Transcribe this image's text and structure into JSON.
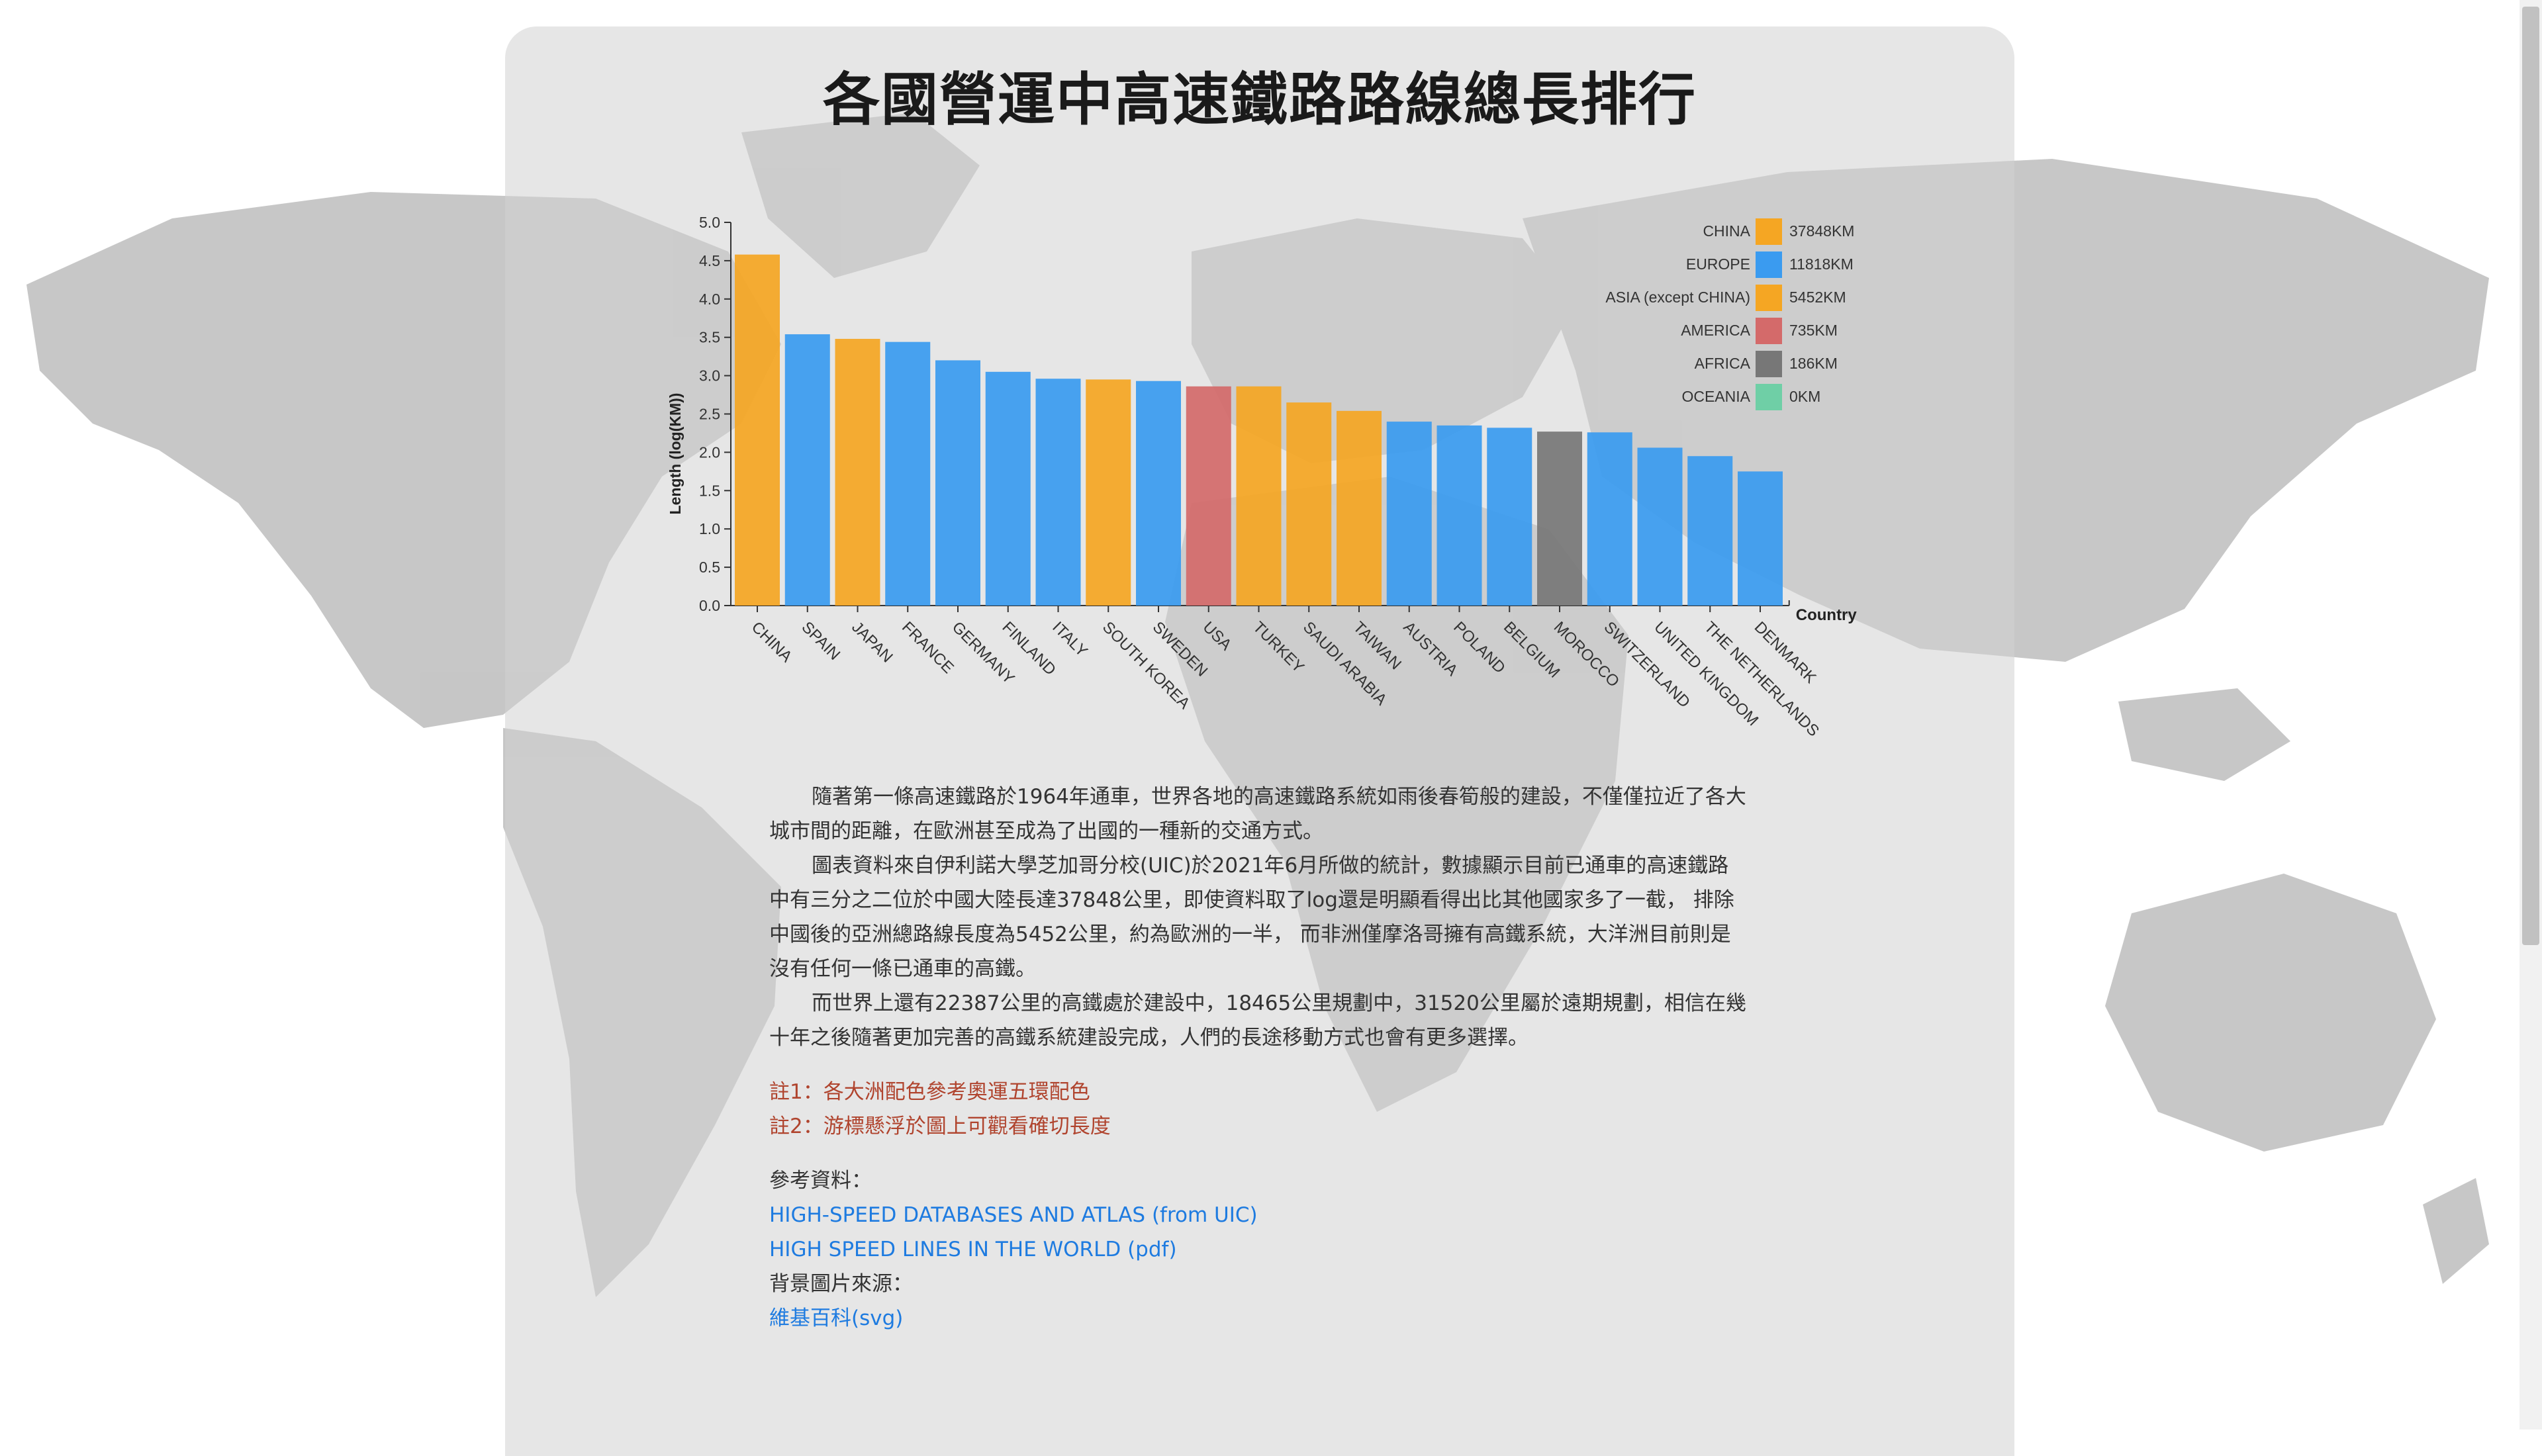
{
  "page": {
    "title": "各國營運中高速鐵路路線總長排行"
  },
  "paragraphs": [
    "隨著第一條高速鐵路於1964年通車，世界各地的高速鐵路系統如雨後春筍般的建設，不僅僅拉近了各大城市間的距離，在歐洲甚至成為了出國的一種新的交通方式。",
    "圖表資料來自伊利諾大學芝加哥分校(UIC)於2021年6月所做的統計，數據顯示目前已通車的高速鐵路中有三分之二位於中國大陸長達37848公里，即使資料取了log還是明顯看得出比其他國家多了一截， 排除中國後的亞洲總路線長度為5452公里，約為歐洲的一半， 而非洲僅摩洛哥擁有高鐵系統，大洋洲目前則是沒有任何一條已通車的高鐵。",
    "而世界上還有22387公里的高鐵處於建設中，18465公里規劃中，31520公里屬於遠期規劃，相信在幾十年之後隨著更加完善的高鐵系統建設完成，人們的長途移動方式也會有更多選擇。"
  ],
  "notes": [
    "註1：各大洲配色參考奧運五環配色",
    "註2：游標懸浮於圖上可觀看確切長度"
  ],
  "references": {
    "label": "參考資料：",
    "links": [
      "HIGH-SPEED DATABASES AND ATLAS (from UIC)",
      "HIGH SPEED LINES IN THE WORLD (pdf)"
    ],
    "bg_label": "背景圖片來源：",
    "bg_link": "維基百科(svg)"
  },
  "colors": {
    "asia": "#f5a623",
    "europe": "#3a9bf0",
    "america": "#d46a6a",
    "africa": "#777777",
    "oceania": "#6fcfa6",
    "note": "#b0442e",
    "link": "#1e7be0"
  },
  "chart_data": {
    "type": "bar",
    "title": "",
    "xlabel": "Country",
    "ylabel": "Length (log(KM))",
    "ylim": [
      0,
      5.0
    ],
    "yticks": [
      "0.0",
      "0.5",
      "1.0",
      "1.5",
      "2.0",
      "2.5",
      "3.0",
      "3.5",
      "4.0",
      "4.5",
      "5.0"
    ],
    "categories": [
      "CHINA",
      "SPAIN",
      "JAPAN",
      "FRANCE",
      "GERMANY",
      "FINLAND",
      "ITALY",
      "SOUTH KOREA",
      "SWEDEN",
      "USA",
      "TURKEY",
      "SAUDI ARABIA",
      "TAIWAN",
      "AUSTRIA",
      "POLAND",
      "BELGIUM",
      "MOROCCO",
      "SWITZERLAND",
      "UNITED KINGDOM",
      "THE NETHERLANDS",
      "DENMARK"
    ],
    "values": [
      4.58,
      3.54,
      3.48,
      3.44,
      3.2,
      3.05,
      2.96,
      2.95,
      2.93,
      2.86,
      2.86,
      2.65,
      2.54,
      2.4,
      2.35,
      2.32,
      2.27,
      2.26,
      2.06,
      1.95,
      1.75
    ],
    "continents": [
      "asia",
      "europe",
      "asia",
      "europe",
      "europe",
      "europe",
      "europe",
      "asia",
      "europe",
      "america",
      "asia",
      "asia",
      "asia",
      "europe",
      "europe",
      "europe",
      "africa",
      "europe",
      "europe",
      "europe",
      "europe"
    ],
    "legend": [
      {
        "name": "CHINA",
        "value": "37848KM",
        "color": "#f5a623"
      },
      {
        "name": "EUROPE",
        "value": "11818KM",
        "color": "#3a9bf0"
      },
      {
        "name": "ASIA (except CHINA)",
        "value": "5452KM",
        "color": "#f5a623"
      },
      {
        "name": "AMERICA",
        "value": "735KM",
        "color": "#d46a6a"
      },
      {
        "name": "AFRICA",
        "value": "186KM",
        "color": "#777777"
      },
      {
        "name": "OCEANIA",
        "value": "0KM",
        "color": "#6fcfa6"
      }
    ],
    "legend_position": "top-right",
    "grid": false
  }
}
